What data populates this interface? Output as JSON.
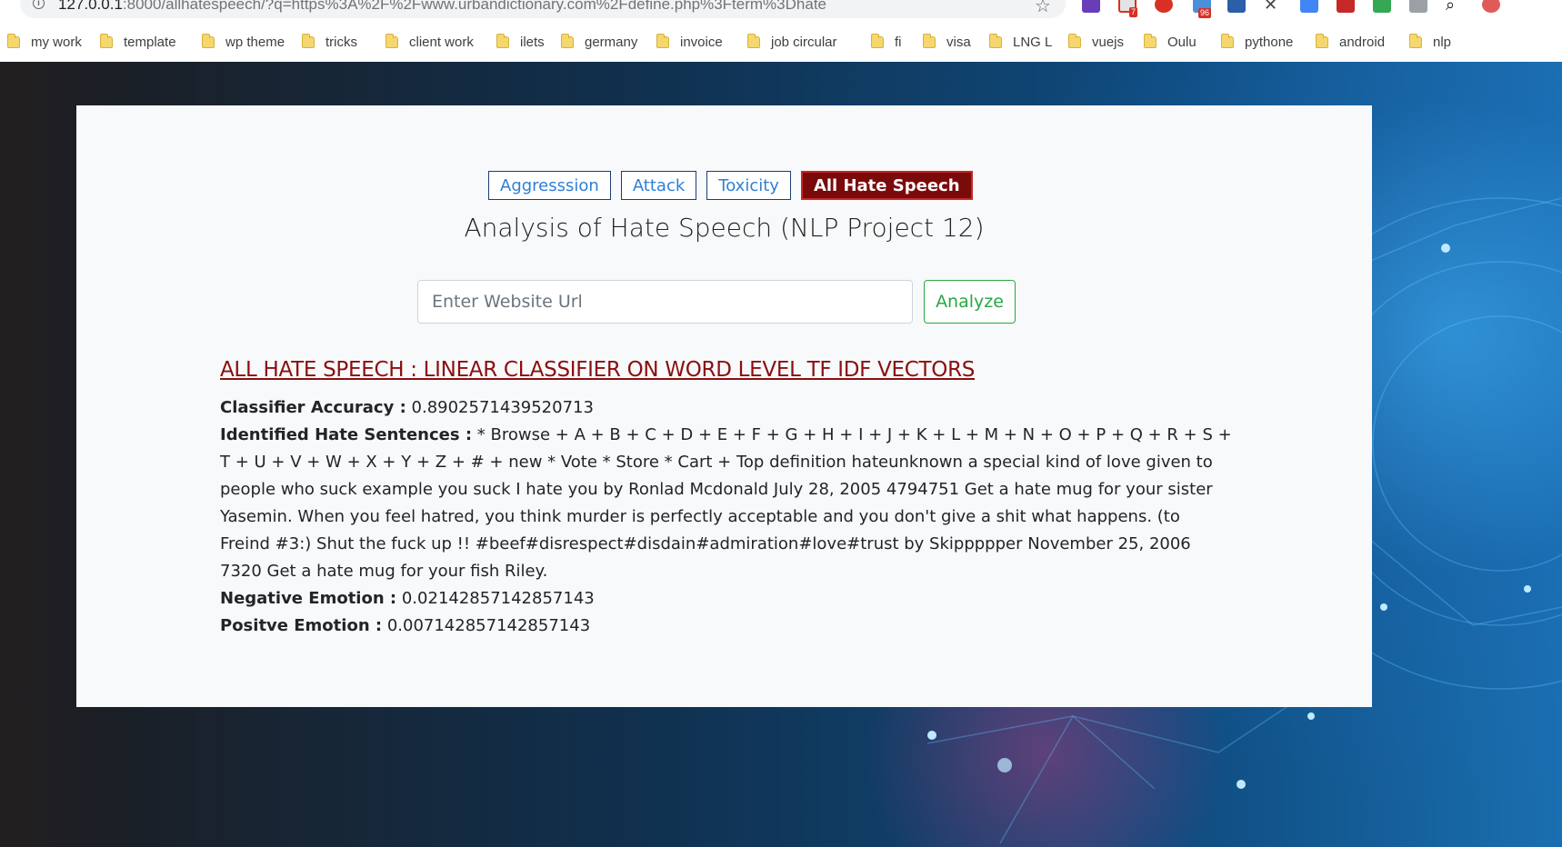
{
  "browser": {
    "url_host": "127.0.0.1",
    "url_rest": ":8000/allhatespeech/?q=https%3A%2F%2Fwww.urbandictionary.com%2Fdefine.php%3Fterm%3Dhate",
    "bookmarks": [
      "my work",
      "template",
      "wp theme",
      "tricks",
      "client work",
      "ilets",
      "germany",
      "invoice",
      "job circular",
      "fi",
      "visa",
      "LNG L",
      "vuejs",
      "Oulu",
      "pythone",
      "android",
      "nlp"
    ],
    "extension_badges": {
      "gmail": "7",
      "ext96": "96",
      "abp": "ABP"
    }
  },
  "nav": {
    "tabs": [
      {
        "label": "Aggresssion",
        "active": false
      },
      {
        "label": "Attack",
        "active": false
      },
      {
        "label": "Toxicity",
        "active": false
      },
      {
        "label": "All Hate Speech",
        "active": true
      }
    ]
  },
  "page": {
    "title": "Analysis of Hate Speech (NLP Project 12)"
  },
  "search": {
    "placeholder": "Enter Website Url",
    "value": "",
    "button_label": "Analyze"
  },
  "result": {
    "heading": "ALL HATE SPEECH : LINEAR CLASSIFIER ON WORD LEVEL TF IDF VECTORS",
    "accuracy_label": "Classifier Accuracy :",
    "accuracy_value": "0.8902571439520713",
    "sentences_label": "Identified Hate Sentences :",
    "sentences_value": "* Browse + A + B + C + D + E + F + G + H + I + J + K + L + M + N + O + P + Q + R + S + T + U + V + W + X + Y + Z + # + new * Vote * Store * Cart + Top definition hateunknown a special kind of love given to people who suck example you suck I hate you by Ronlad Mcdonald July 28, 2005 4794751 Get a hate mug for your sister Yasemin. When you feel hatred, you think murder is perfectly acceptable and you don't give a shit what happens. (to Freind #3:) Shut the fuck up !! #beef#disrespect#disdain#admiration#love#trust by Skippppper November 25, 2006 7320 Get a hate mug for your fish Riley.",
    "negative_label": "Negative Emotion :",
    "negative_value": "0.02142857142857143",
    "positive_label": "Positve Emotion :",
    "positive_value": "0.007142857142857143"
  },
  "colors": {
    "active_tab": "#7b0a0a",
    "link_blue": "#2f7fd4",
    "analyze_green": "#28a745",
    "heading_red": "#8b0f0f"
  }
}
